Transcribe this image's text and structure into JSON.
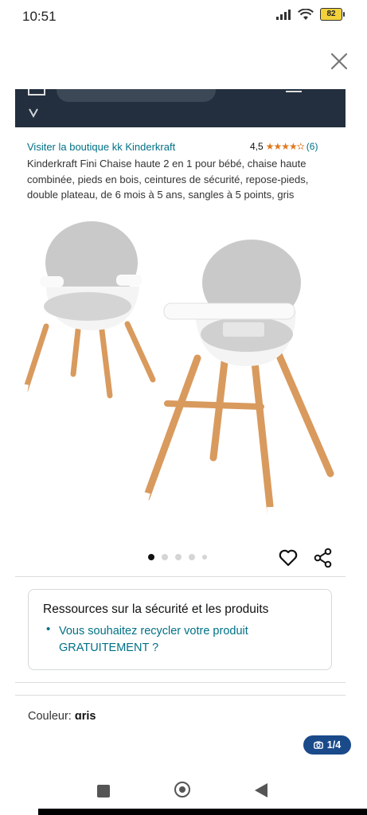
{
  "status_bar": {
    "time": "10:51",
    "battery": "82"
  },
  "store": {
    "link_text": "Visiter la boutique kk Kinderkraft",
    "rating_value": "4,5",
    "rating_count": "(6)"
  },
  "product": {
    "title": "Kinderkraft Fini Chaise haute 2 en 1 pour bébé, chaise haute combinée, pieds en bois, ceintures de sécurité, repose-pieds, double plateau, de 6 mois à 5 ans, sangles à 5 points, gris",
    "image_count": 5,
    "active_image": 1
  },
  "safety": {
    "heading": "Ressources sur la sécurité et les produits",
    "bullet": "•",
    "link": "Vous souhaitez recycler votre produit GRATUITEMENT ?"
  },
  "color": {
    "label": "Couleur:",
    "value": "gris"
  },
  "viewer": {
    "counter": "1/4"
  },
  "icons": [
    "close-icon",
    "heart-icon",
    "share-icon",
    "camera-icon",
    "signal-icon",
    "wifi-icon",
    "battery-icon",
    "star-icon"
  ],
  "colors": {
    "header_bg": "#232f3e",
    "link": "#007185",
    "star": "#de7921",
    "badge": "#1a4a8a"
  }
}
